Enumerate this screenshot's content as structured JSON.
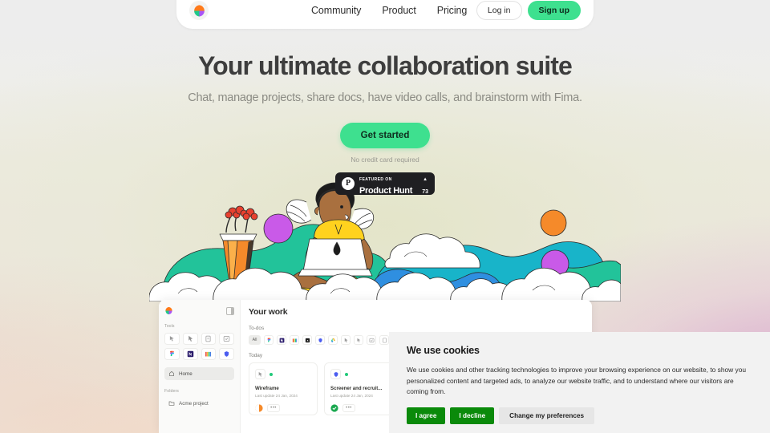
{
  "navbar": {
    "logo_icon": "fima-logo-icon",
    "links": [
      {
        "label": "Community"
      },
      {
        "label": "Product"
      },
      {
        "label": "Pricing"
      }
    ],
    "login_label": "Log in",
    "signup_label": "Sign up"
  },
  "hero": {
    "title": "Your ultimate collaboration suite",
    "subtitle": "Chat, manage projects, share docs, have video calls, and brainstorm with Fima.",
    "cta_label": "Get started",
    "cta_note": "No credit card required",
    "product_hunt": {
      "logo_letter": "P",
      "kicker": "FEATURED ON",
      "name": "Product Hunt",
      "arrow": "▲",
      "count": "73"
    }
  },
  "app_mockup": {
    "sidebar": {
      "logo_icon": "fima-logo-icon",
      "panel_toggle_icon": "panel-toggle-icon",
      "tools_label": "Tools",
      "tools": [
        {
          "name": "cursor-click-icon"
        },
        {
          "name": "cursor-pointer-icon"
        },
        {
          "name": "document-icon"
        },
        {
          "name": "checkbox-icon"
        },
        {
          "name": "figma-icon"
        },
        {
          "name": "notion-icon"
        },
        {
          "name": "library-icon"
        },
        {
          "name": "shield-icon"
        }
      ],
      "nav": [
        {
          "label": "Home",
          "icon": "home-icon",
          "active": true
        }
      ],
      "folders_label": "Folders",
      "folders": [
        {
          "label": "Acme project",
          "icon": "folder-icon"
        }
      ]
    },
    "main": {
      "title": "Your work",
      "todos_label": "To-dos",
      "filters": [
        {
          "label": "All",
          "name": "filter-all"
        },
        {
          "name": "figma-icon"
        },
        {
          "name": "notion-icon"
        },
        {
          "name": "library-icon"
        },
        {
          "name": "screenshot-icon"
        },
        {
          "name": "shield-icon"
        },
        {
          "name": "drive-icon"
        },
        {
          "name": "cursor-pointer-icon"
        },
        {
          "name": "cursor-click-icon"
        },
        {
          "name": "checkbox-icon"
        },
        {
          "name": "document-icon"
        }
      ],
      "today_label": "Today",
      "cards": [
        {
          "app_icon": "cursor-click-icon",
          "status": "active",
          "title": "Wireframe",
          "meta": "Last update 24 Jan, 2024",
          "more_label": "•••"
        },
        {
          "app_icon": "shield-icon",
          "status": "active",
          "title": "Screener and recruit...",
          "meta": "Last update 24 Jan, 2024",
          "more_label": "•••"
        }
      ]
    }
  },
  "cookie_banner": {
    "title": "We use cookies",
    "body": "We use cookies and other tracking technologies to improve your browsing experience on our website, to show you personalized content and targeted ads, to analyze our website traffic, and to understand where our visitors are coming from.",
    "agree_label": "I agree",
    "decline_label": "I decline",
    "preferences_label": "Change my preferences"
  },
  "colors": {
    "accent_green": "#3ee08f",
    "cookie_green": "#0a8a0a",
    "logo_orange": "#ff7a1a",
    "logo_green": "#1ec98a",
    "logo_purple": "#a855f7",
    "badge_dark": "#1f1f22"
  }
}
